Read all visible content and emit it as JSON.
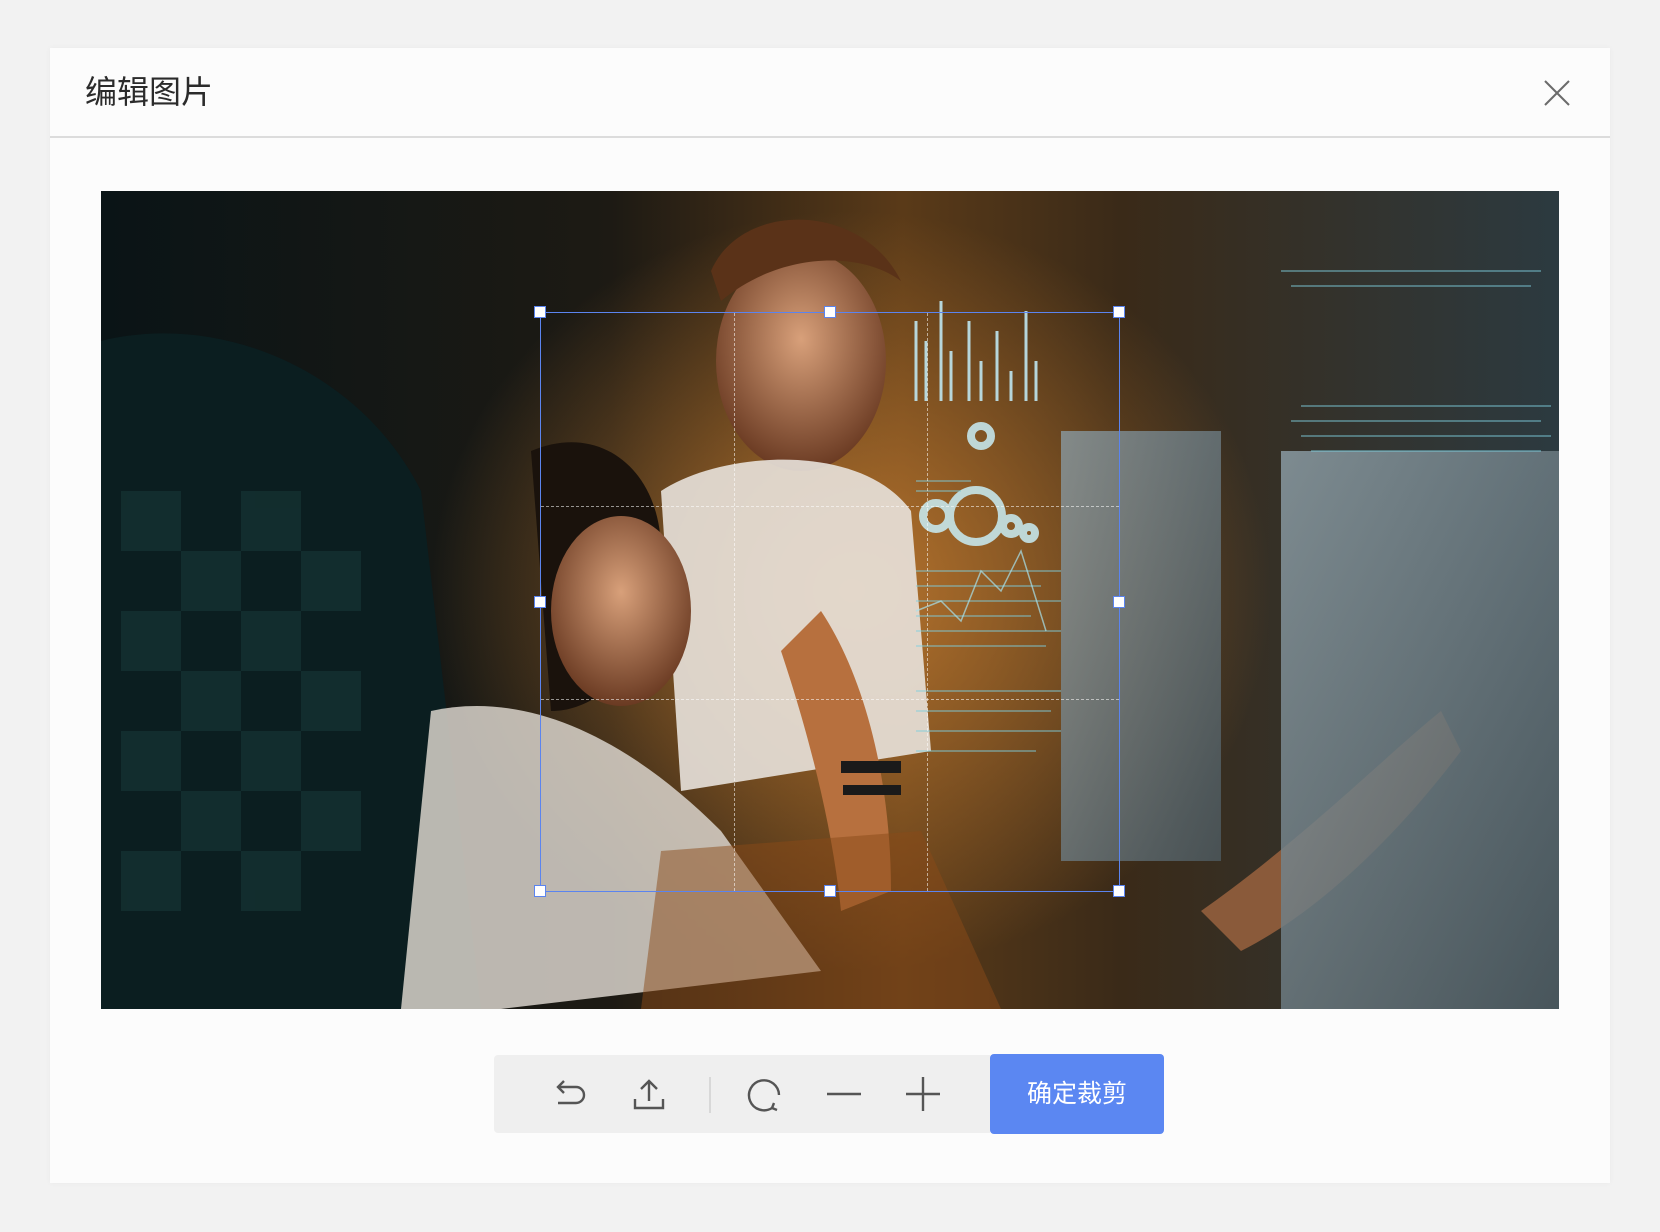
{
  "dialog": {
    "title": "编辑图片",
    "close_icon": "close-icon"
  },
  "toolbar": {
    "tools": [
      {
        "name": "undo-icon"
      },
      {
        "name": "upload-icon"
      },
      {
        "name": "rotate-icon"
      },
      {
        "name": "zoom-out-icon"
      },
      {
        "name": "zoom-in-icon"
      }
    ],
    "confirm_label": "确定裁剪"
  },
  "colors": {
    "accent": "#5b87f2",
    "crop_border": "#5b84ef",
    "toolbar_bg": "#efefef",
    "page_bg": "#f2f2f2"
  }
}
